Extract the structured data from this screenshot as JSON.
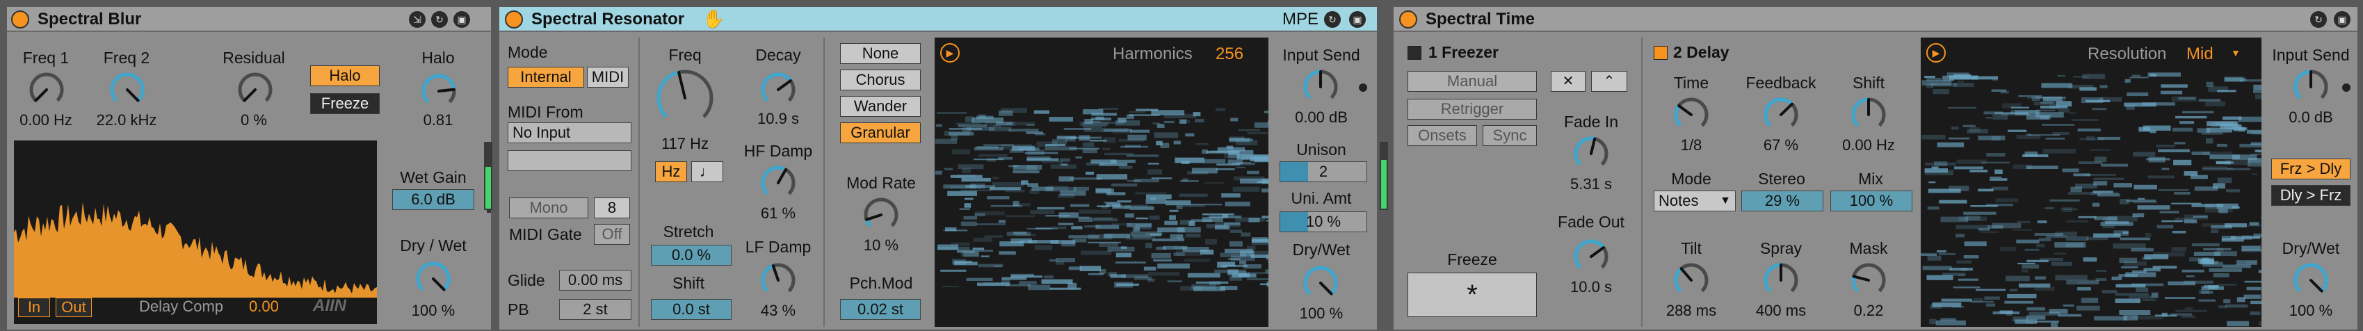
{
  "blur": {
    "title": "Spectral Blur",
    "freq1": {
      "label": "Freq 1",
      "value": "0.00 Hz"
    },
    "freq2": {
      "label": "Freq 2",
      "value": "22.0 kHz"
    },
    "residual": {
      "label": "Residual",
      "value": "0 %"
    },
    "halo_button": "Halo",
    "freeze_button": "Freeze",
    "halo_knob": {
      "label": "Halo",
      "value": "0.81"
    },
    "wet_gain": {
      "label": "Wet Gain",
      "value": "6.0 dB"
    },
    "dry_wet": {
      "label": "Dry / Wet",
      "value": "100 %"
    },
    "in_button": "In",
    "out_button": "Out",
    "delay_comp_label": "Delay Comp",
    "delay_comp_value": "0.00",
    "logo": "AIIN"
  },
  "resonator": {
    "title": "Spectral Resonator",
    "mpe": "MPE",
    "mode_label": "Mode",
    "mode_internal": "Internal",
    "mode_midi": "MIDI",
    "midi_from_label": "MIDI From",
    "midi_from_value": "No Input",
    "mono_button": "Mono",
    "voices": "8",
    "midi_gate_label": "MIDI Gate",
    "midi_gate_value": "Off",
    "glide_label": "Glide",
    "glide_value": "0.00 ms",
    "pb_label": "PB",
    "pb_value": "2 st",
    "freq": {
      "label": "Freq",
      "value": "117 Hz"
    },
    "hz_button": "Hz",
    "note_button": "♩",
    "stretch": {
      "label": "Stretch",
      "value": "0.0 %"
    },
    "shift": {
      "label": "Shift",
      "value": "0.0 st"
    },
    "decay": {
      "label": "Decay",
      "value": "10.9 s"
    },
    "hf_damp": {
      "label": "HF Damp",
      "value": "61 %"
    },
    "lf_damp": {
      "label": "LF Damp",
      "value": "43 %"
    },
    "mod_options": [
      "None",
      "Chorus",
      "Wander",
      "Granular"
    ],
    "mod_selected": "Granular",
    "mod_rate": {
      "label": "Mod Rate",
      "value": "10 %"
    },
    "pch_mod": {
      "label": "Pch.Mod",
      "value": "0.02 st"
    },
    "harmonics_label": "Harmonics",
    "harmonics_value": "256",
    "input_send": {
      "label": "Input Send",
      "value": "0.00 dB"
    },
    "unison": {
      "label": "Unison",
      "value": "2"
    },
    "uni_amt": {
      "label": "Uni. Amt",
      "value": "10 %"
    },
    "dry_wet": {
      "label": "Dry/Wet",
      "value": "100 %"
    }
  },
  "time": {
    "title": "Spectral Time",
    "freezer_label": "1 Freezer",
    "manual_button": "Manual",
    "retrigger_button": "Retrigger",
    "onsets_button": "Onsets",
    "sync_button": "Sync",
    "fade_in": {
      "label": "Fade In",
      "value": "5.31 s"
    },
    "fade_out": {
      "label": "Fade Out",
      "value": "10.0 s"
    },
    "freeze_label": "Freeze",
    "freeze_button": "*",
    "delay_label": "2 Delay",
    "time_knob": {
      "label": "Time",
      "value": "1/8"
    },
    "feedback": {
      "label": "Feedback",
      "value": "67 %"
    },
    "shift": {
      "label": "Shift",
      "value": "0.00 Hz"
    },
    "mode_label": "Mode",
    "mode_value": "Notes",
    "stereo": {
      "label": "Stereo",
      "value": "29 %"
    },
    "mix": {
      "label": "Mix",
      "value": "100 %"
    },
    "tilt": {
      "label": "Tilt",
      "value": "288 ms"
    },
    "spray": {
      "label": "Spray",
      "value": "400 ms"
    },
    "mask": {
      "label": "Mask",
      "value": "0.22"
    },
    "resolution_label": "Resolution",
    "resolution_value": "Mid",
    "input_send": {
      "label": "Input Send",
      "value": "0.0 dB"
    },
    "frz_dly": "Frz > Dly",
    "dly_frz": "Dly > Frz",
    "dry_wet": {
      "label": "Dry/Wet",
      "value": "100 %"
    }
  },
  "colors": {
    "accent": "#f7931e",
    "blue": "#3f8fb0",
    "active_title": "#9fd6e2"
  },
  "knob_levels": {
    "blur_freq1": 0.0,
    "blur_freq2": 1.0,
    "blur_residual": 0.0,
    "blur_halo": 0.81,
    "blur_drywet": 1.0,
    "res_freq": 0.45,
    "res_decay": 0.7,
    "res_hf": 0.61,
    "res_lf": 0.43,
    "res_modrate": 0.1,
    "res_input": 0.5,
    "res_drywet": 1.0,
    "time_fadein": 0.55,
    "time_fadeout": 0.7,
    "time_time": 0.3,
    "time_feedback": 0.67,
    "time_shift": 0.5,
    "time_tilt": 0.35,
    "time_spray": 0.5,
    "time_mask": 0.22,
    "time_input": 0.5,
    "time_drywet": 1.0
  }
}
